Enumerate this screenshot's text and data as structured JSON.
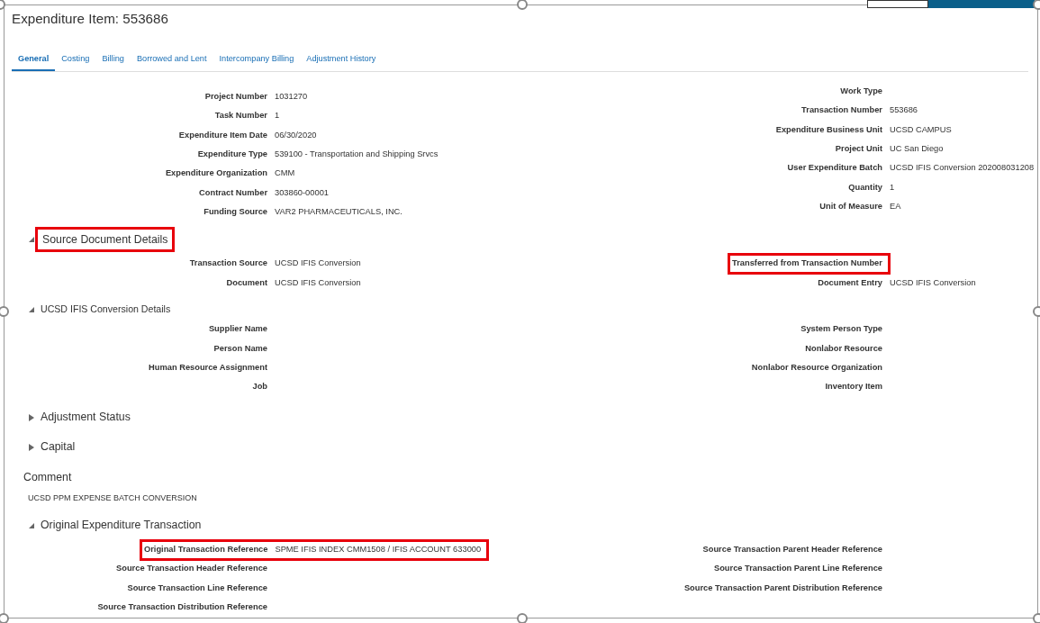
{
  "title": "Expenditure Item: 553686",
  "tabs": [
    {
      "label": "General",
      "selected": true
    },
    {
      "label": "Costing",
      "selected": false
    },
    {
      "label": "Billing",
      "selected": false
    },
    {
      "label": "Borrowed and Lent",
      "selected": false
    },
    {
      "label": "Intercompany Billing",
      "selected": false
    },
    {
      "label": "Adjustment History",
      "selected": false
    }
  ],
  "general": {
    "left": [
      {
        "label": "Project Number",
        "value": "1031270",
        "highlighted": false
      },
      {
        "label": "Task Number",
        "value": "1",
        "highlighted": false
      },
      {
        "label": "Expenditure Item Date",
        "value": "06/30/2020",
        "highlighted": false
      },
      {
        "label": "Expenditure Type",
        "value": "539100 - Transportation and Shipping Srvcs",
        "highlighted": false
      },
      {
        "label": "Expenditure Organization",
        "value": "CMM",
        "highlighted": false
      },
      {
        "label": "Contract Number",
        "value": "303860-00001",
        "highlighted": false
      },
      {
        "label": "Funding Source",
        "value": "VAR2 PHARMACEUTICALS, INC.",
        "highlighted": false
      }
    ],
    "right": [
      {
        "label": "Work Type",
        "highlighted": false
      },
      {
        "label": "Transaction Number",
        "value": "553686",
        "highlighted": false
      },
      {
        "label": "Expenditure Business Unit",
        "value": "UCSD CAMPUS",
        "highlighted": false
      },
      {
        "label": "Project Unit",
        "value": "UC San Diego",
        "highlighted": false
      },
      {
        "label": "User Expenditure Batch",
        "value": "UCSD IFIS Conversion 202008031208",
        "highlighted": false
      },
      {
        "label": "Quantity",
        "value": "1",
        "highlighted": false
      },
      {
        "label": "Unit of Measure",
        "value": "EA",
        "highlighted": false
      }
    ]
  },
  "sections": [
    {
      "kind": "section",
      "title": "Source Document Details",
      "expanded": true,
      "highlighted": true,
      "left": [
        {
          "label": "Transaction Source",
          "value": "UCSD IFIS Conversion",
          "highlighted": false
        },
        {
          "label": "Document",
          "value": "UCSD IFIS Conversion",
          "highlighted": false
        }
      ],
      "right": [
        {
          "label": "Transferred from Transaction Number",
          "highlighted": true
        },
        {
          "label": "Document Entry",
          "value": "UCSD IFIS Conversion",
          "highlighted": false
        }
      ]
    },
    {
      "kind": "subsection",
      "title": "UCSD IFIS Conversion Details",
      "expanded": true,
      "highlighted": false,
      "left": [
        {
          "label": "Supplier Name",
          "highlighted": false
        },
        {
          "label": "Person Name",
          "highlighted": false
        },
        {
          "label": "Human Resource Assignment",
          "highlighted": false
        },
        {
          "label": "Job",
          "highlighted": false
        }
      ],
      "right": [
        {
          "label": "System Person Type",
          "highlighted": false
        },
        {
          "label": "Nonlabor Resource",
          "highlighted": false
        },
        {
          "label": "Nonlabor Resource Organization",
          "highlighted": false
        },
        {
          "label": "Inventory Item",
          "highlighted": false
        }
      ]
    },
    {
      "kind": "section",
      "title": "Adjustment Status",
      "expanded": false,
      "highlighted": false
    },
    {
      "kind": "section",
      "title": "Capital",
      "expanded": false,
      "highlighted": false
    },
    {
      "kind": "comment",
      "title": "Comment",
      "text": "UCSD PPM EXPENSE BATCH CONVERSION"
    },
    {
      "kind": "section",
      "title": "Original Expenditure Transaction",
      "expanded": true,
      "highlighted": false,
      "left": [
        {
          "label": "Original Transaction Reference",
          "value": "SPME IFIS INDEX CMM1508 / IFIS ACCOUNT 633000",
          "highlighted": true
        },
        {
          "label": "Source Transaction Header Reference",
          "highlighted": false
        },
        {
          "label": "Source Transaction Line Reference",
          "highlighted": false
        },
        {
          "label": "Source Transaction Distribution Reference",
          "highlighted": false
        }
      ],
      "right": [
        {
          "label": "Source Transaction Parent Header Reference",
          "highlighted": false
        },
        {
          "label": "Source Transaction Parent Line Reference",
          "highlighted": false
        },
        {
          "label": "Source Transaction Parent Distribution Reference",
          "highlighted": false
        }
      ]
    }
  ]
}
